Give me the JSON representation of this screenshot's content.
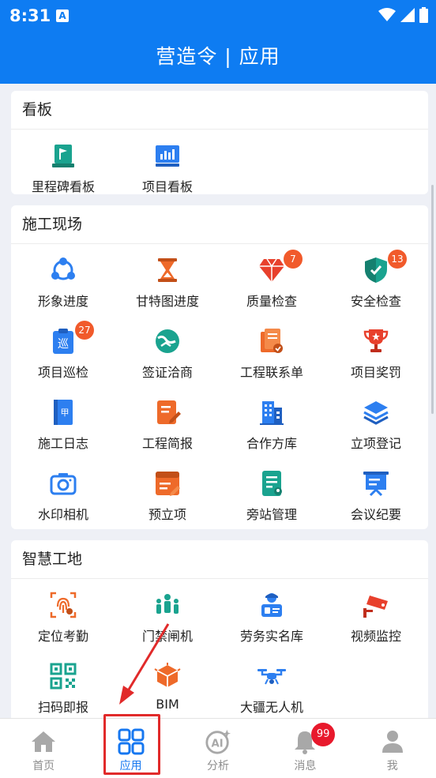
{
  "status_bar": {
    "time": "8:31",
    "notif_letter": "A"
  },
  "app_bar": {
    "title": "营造令 | 应用"
  },
  "sections": [
    {
      "title": "看板",
      "items": [
        {
          "label": "里程碑看板",
          "icon": "milestone-flag-icon",
          "color": "#1aa38f"
        },
        {
          "label": "项目看板",
          "icon": "bar-chart-board-icon",
          "color": "#2d7ff0"
        }
      ]
    },
    {
      "title": "施工现场",
      "items": [
        {
          "label": "形象进度",
          "icon": "progress-nodes-icon",
          "color": "#2d7ff0"
        },
        {
          "label": "甘特图进度",
          "icon": "hourglass-icon",
          "color": "#ee6a2a"
        },
        {
          "label": "质量检查",
          "icon": "diamond-icon",
          "color": "#e8402c",
          "badge": "7"
        },
        {
          "label": "安全检查",
          "icon": "shield-check-icon",
          "color": "#1aa38f",
          "badge": "13"
        },
        {
          "label": "项目巡检",
          "icon": "patrol-clipboard-icon",
          "color": "#2d7ff0",
          "badge": "27"
        },
        {
          "label": "签证洽商",
          "icon": "handshake-globe-icon",
          "color": "#1aa38f"
        },
        {
          "label": "工程联系单",
          "icon": "contact-sheet-icon",
          "color": "#ee6a2a"
        },
        {
          "label": "项目奖罚",
          "icon": "trophy-icon",
          "color": "#e8402c"
        },
        {
          "label": "施工日志",
          "icon": "log-book-icon",
          "color": "#2d7ff0"
        },
        {
          "label": "工程简报",
          "icon": "report-edit-icon",
          "color": "#ee6a2a"
        },
        {
          "label": "合作方库",
          "icon": "buildings-icon",
          "color": "#2d7ff0"
        },
        {
          "label": "立项登记",
          "icon": "stack-layers-icon",
          "color": "#2d7ff0"
        },
        {
          "label": "水印相机",
          "icon": "camera-icon",
          "color": "#2d7ff0"
        },
        {
          "label": "预立项",
          "icon": "pre-project-folder-icon",
          "color": "#ee6a2a"
        },
        {
          "label": "旁站管理",
          "icon": "supervision-doc-icon",
          "color": "#1aa38f"
        },
        {
          "label": "会议纪要",
          "icon": "meeting-board-icon",
          "color": "#2d7ff0"
        }
      ]
    },
    {
      "title": "智慧工地",
      "items": [
        {
          "label": "定位考勤",
          "icon": "fingerprint-location-icon",
          "color": "#ee6a2a"
        },
        {
          "label": "门禁闸机",
          "icon": "turnstile-people-icon",
          "color": "#1aa38f"
        },
        {
          "label": "劳务实名库",
          "icon": "worker-id-icon",
          "color": "#2d7ff0"
        },
        {
          "label": "视频监控",
          "icon": "cctv-camera-icon",
          "color": "#e8402c"
        },
        {
          "label": "扫码即报",
          "icon": "qr-code-icon",
          "color": "#1aa38f"
        },
        {
          "label": "BIM",
          "icon": "bim-cube-icon",
          "color": "#ee6a2a"
        },
        {
          "label": "大疆无人机",
          "icon": "drone-icon",
          "color": "#2d7ff0"
        }
      ]
    }
  ],
  "bottom_nav": [
    {
      "label": "首页",
      "icon": "home-icon"
    },
    {
      "label": "应用",
      "icon": "apps-grid-icon",
      "active": true
    },
    {
      "label": "分析",
      "icon": "ai-analysis-icon"
    },
    {
      "label": "消息",
      "icon": "bell-icon",
      "badge": "99"
    },
    {
      "label": "我",
      "icon": "person-icon"
    }
  ],
  "colors": {
    "primary": "#0e7cf2",
    "active_tab": "#1677f0",
    "badge": "#f15a2b",
    "nav_badge": "#e8192c",
    "annotation": "#e12a2a"
  }
}
